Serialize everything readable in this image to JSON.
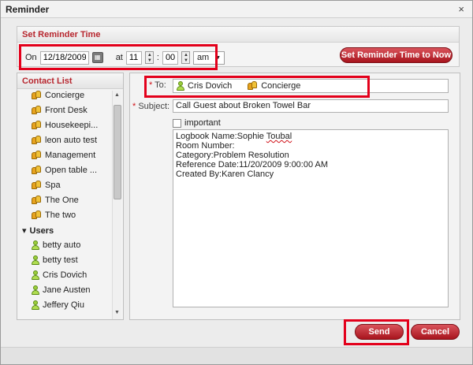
{
  "dialog": {
    "title": "Reminder",
    "close_glyph": "×"
  },
  "reminder_time": {
    "section_title": "Set Reminder Time",
    "on_label": "On",
    "date_value": "12/18/2009",
    "at_label": "at",
    "hour_value": "11",
    "separator": ":",
    "minute_value": "00",
    "ampm_value": "am",
    "ampm_caret": "▼",
    "set_now_label": "Set Reminder Time to Now"
  },
  "contacts": {
    "section_title": "Contact List",
    "groups": [
      {
        "label": "Concierge"
      },
      {
        "label": "Front Desk"
      },
      {
        "label": "Housekeepi..."
      },
      {
        "label": "leon auto test"
      },
      {
        "label": "Management"
      },
      {
        "label": "Open table ..."
      },
      {
        "label": "Spa"
      },
      {
        "label": "The One"
      },
      {
        "label": "The two"
      }
    ],
    "users_header": "Users",
    "users_caret": "▾",
    "users": [
      {
        "label": "betty auto"
      },
      {
        "label": "betty test"
      },
      {
        "label": "Cris Dovich"
      },
      {
        "label": "Jane Austen"
      },
      {
        "label": "Jeffery Qiu"
      }
    ]
  },
  "compose": {
    "to_label": "To:",
    "required_mark": "*",
    "recipients": [
      {
        "label": "Cris Dovich",
        "kind": "user"
      },
      {
        "label": "Concierge",
        "kind": "group"
      }
    ],
    "subject_label": "Subject:",
    "subject_value": "Call Guest about Broken Towel Bar",
    "important_label": "important",
    "body_lines": [
      "Logbook Name:Sophie Toubal",
      "Room Number:",
      "Category:Problem Resolution",
      "Reference Date:11/20/2009 9:00:00 AM",
      "Created By:Karen Clancy"
    ],
    "body_first_prefix": "Logbook Name:Sophie ",
    "body_first_squiggle": "Toubal"
  },
  "footer": {
    "send_label": "Send",
    "cancel_label": "Cancel"
  },
  "colors": {
    "accent_red": "#b7262e",
    "highlight_red": "#e3001b"
  }
}
